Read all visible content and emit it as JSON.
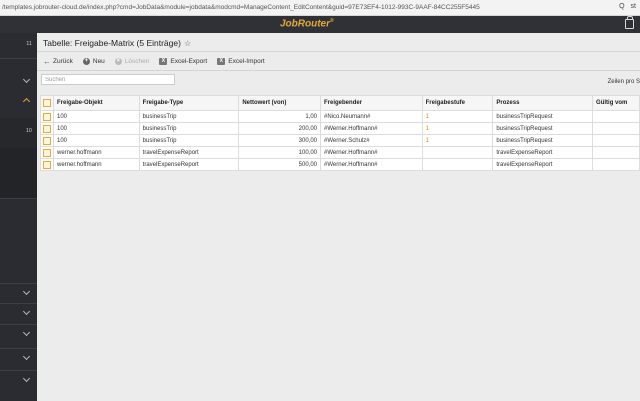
{
  "browser": {
    "url": "/templates.jobrouter-cloud.de/index.php?cmd=JobData&module=jobdata&modcmd=ManageContent_EditContent&guid=97E73EF4-1012-993C-9AAF-84CC255F5445",
    "right_icons": [
      "Q",
      "st"
    ]
  },
  "app": {
    "logo": "JobRouter",
    "logo_mark": "®"
  },
  "sidebar": {
    "counts": [
      "11",
      "10"
    ]
  },
  "page": {
    "title": "Tabelle: Freigabe-Matrix (5 Einträge)",
    "star": "☆"
  },
  "toolbar": {
    "back": "Zurück",
    "new": "Neu",
    "delete": "Löschen",
    "excel_export": "Excel-Export",
    "excel_import": "Excel-Import"
  },
  "search": {
    "placeholder": "Suchen"
  },
  "pager": {
    "rows_per_page": "Zeilen pro S"
  },
  "table": {
    "headers": [
      "Freigabe-Objekt",
      "Freigabe-Type",
      "Nettowert (von)",
      "Freigebender",
      "Freigabestufe",
      "Prozess",
      "Gültig vom"
    ],
    "rows": [
      [
        "100",
        "businessTrip",
        "1,00",
        "#Nico.Neumann#",
        "1",
        "businessTripRequest",
        ""
      ],
      [
        "100",
        "businessTrip",
        "200,00",
        "#Werner.Hoffmann#",
        "1",
        "businessTripRequest",
        ""
      ],
      [
        "100",
        "businessTrip",
        "300,00",
        "#Werner.Schulz#",
        "1",
        "businessTripRequest",
        ""
      ],
      [
        "werner.hoffmann",
        "travelExpenseReport",
        "100,00",
        "#Werner.Hoffmann#",
        "",
        "travelExpenseReport",
        ""
      ],
      [
        "werner.hoffmann",
        "travelExpenseReport",
        "500,00",
        "#Werner.Hoffmann#",
        "",
        "travelExpenseReport",
        ""
      ]
    ]
  },
  "colors": {
    "accent": "#e5a93a",
    "header_bg": "#2f3137",
    "sidebar_bg": "#2a2c31"
  }
}
